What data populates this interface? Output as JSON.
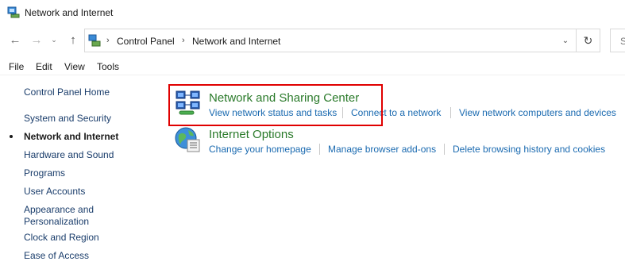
{
  "window": {
    "title": "Network and Internet"
  },
  "address": {
    "crumbs": [
      "Control Panel",
      "Network and Internet"
    ],
    "search_placeholder": "S"
  },
  "menu": [
    "File",
    "Edit",
    "View",
    "Tools"
  ],
  "sidebar": {
    "home": "Control Panel Home",
    "items": [
      {
        "label": "System and Security",
        "active": false
      },
      {
        "label": "Network and Internet",
        "active": true
      },
      {
        "label": "Hardware and Sound",
        "active": false
      },
      {
        "label": "Programs",
        "active": false
      },
      {
        "label": "User Accounts",
        "active": false
      },
      {
        "label": "Appearance and Personalization",
        "active": false
      },
      {
        "label": "Clock and Region",
        "active": false
      },
      {
        "label": "Ease of Access",
        "active": false
      }
    ]
  },
  "categories": [
    {
      "title": "Network and Sharing Center",
      "icon": "network-sharing-center-icon",
      "tasks": [
        "View network status and tasks",
        "Connect to a network",
        "View network computers and devices"
      ]
    },
    {
      "title": "Internet Options",
      "icon": "internet-options-icon",
      "tasks": [
        "Change your homepage",
        "Manage browser add-ons",
        "Delete browsing history and cookies"
      ]
    }
  ],
  "colors": {
    "category_title": "#2a7a2a",
    "task_link": "#1a6ab0",
    "highlight": "#e00000"
  }
}
